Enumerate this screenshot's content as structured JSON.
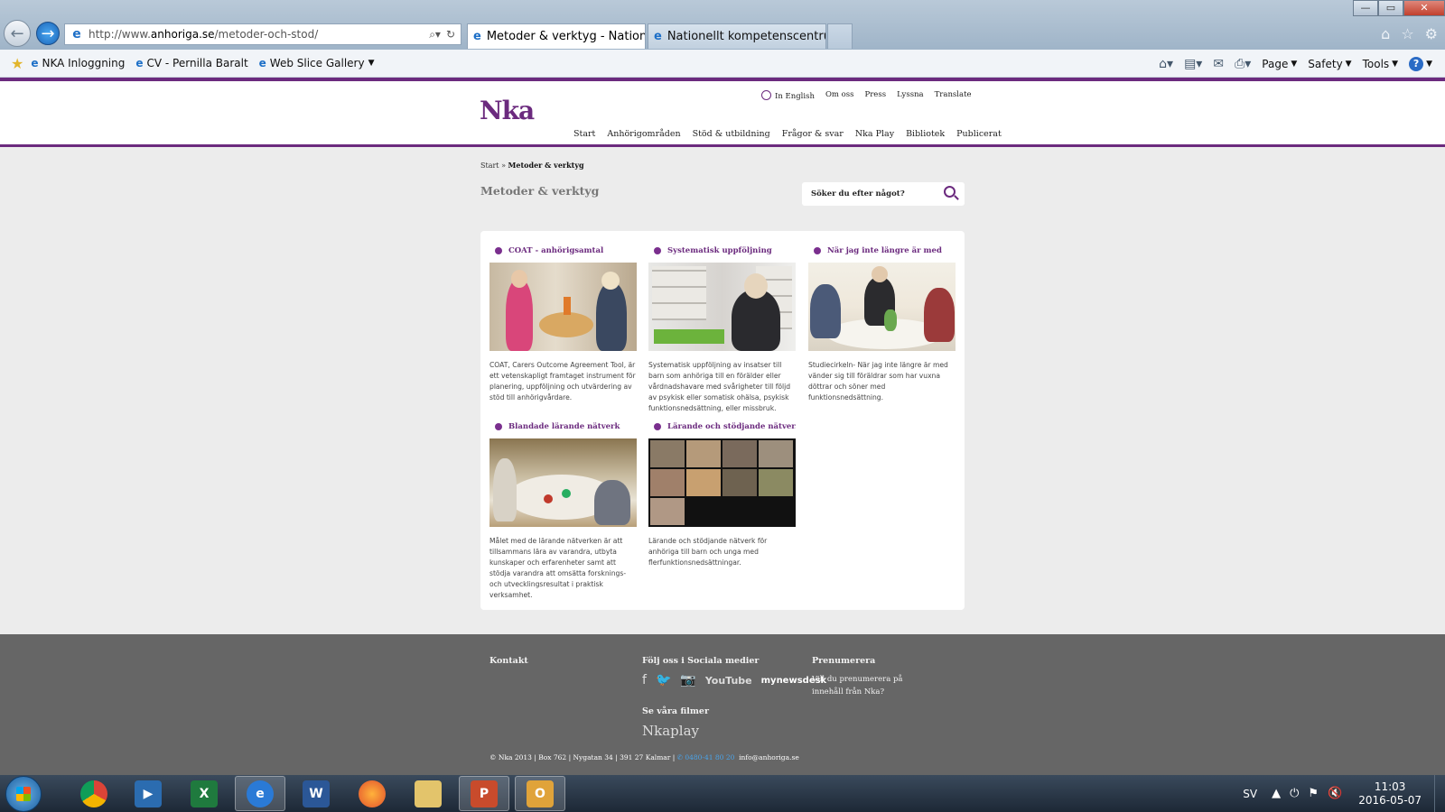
{
  "browser": {
    "url_prefix": "http://www.",
    "url_domain": "anhoriga.se",
    "url_path": "/metoder-och-stod/",
    "tabs": [
      {
        "label": "Metoder & verktyg - Nation...",
        "close": "×"
      },
      {
        "label": "Nationellt kompetenscentrum ..."
      }
    ],
    "window": {
      "minimize": "—",
      "restore": "▭",
      "close": "✕"
    },
    "favorites": [
      {
        "label": "NKA  Inloggning"
      },
      {
        "label": "CV - Pernilla Baralt"
      },
      {
        "label": "Web Slice Gallery"
      }
    ],
    "commands": {
      "page": "Page",
      "safety": "Safety",
      "tools": "Tools"
    }
  },
  "site": {
    "logo": "Nka",
    "util_nav": [
      "In English",
      "Om oss",
      "Press",
      "Lyssna",
      "Translate"
    ],
    "main_nav": [
      "Start",
      "Anhörigområden",
      "Stöd & utbildning",
      "Frågor & svar",
      "Nka Play",
      "Bibliotek",
      "Publicerat"
    ],
    "breadcrumb": {
      "root": "Start",
      "sep": "»",
      "current": "Metoder & verktyg"
    },
    "page_title": "Metoder & verktyg",
    "search_placeholder": "Söker du efter något?",
    "cards": [
      {
        "title": "COAT - anhörigsamtal",
        "desc": "COAT, Carers Outcome Agreement Tool, är ett vetenskapligt framtaget instrument för planering, uppföljning och utvärdering av stöd till anhörigvårdare."
      },
      {
        "title": "Systematisk uppföljning",
        "desc": "Systematisk uppföljning av insatser till barn som anhöriga till en förälder eller vårdnadshavare med svårigheter till följd av psykisk eller somatisk ohälsa, psykisk funktionsnedsättning, eller missbruk."
      },
      {
        "title": "När jag inte längre är med",
        "desc": "Studiecirkeln- När jag inte längre är med vänder sig till föräldrar som har vuxna döttrar och söner med funktionsnedsättning."
      },
      {
        "title": "Blandade lärande nätverk",
        "desc": "Målet med de lärande nätverken är att tillsammans lära av varandra, utbyta kunskaper och erfarenheter samt att stödja varandra att omsätta forsknings- och utvecklingsresultat i praktisk verksamhet."
      },
      {
        "title": "Lärande och stödjande nätver...",
        "desc": "Lärande och stödjande nätverk för anhöriga till barn och unga med flerfunktionsnedsättningar."
      }
    ],
    "footer": {
      "contact_heading": "Kontakt",
      "social_heading": "Följ oss i Sociala medier",
      "social": {
        "facebook": "f",
        "twitter": "🐦",
        "instagram": "📷",
        "youtube": "YouTube",
        "newsdesk": "mynewsdesk"
      },
      "films_heading": "Se våra filmer",
      "play_logo_a": "Nka",
      "play_logo_b": "play",
      "subscribe_heading": "Prenumerera",
      "subscribe_text": "Vill du prenumerera på innehåll från Nka?",
      "address": "© Nka 2013 | Box 762 | Nygatan 34 | 391 27 Kalmar |",
      "phone": "0480-41 80 20",
      "email": "info@anhoriga.se"
    }
  },
  "taskbar": {
    "language": "SV",
    "time": "11:03",
    "date": "2016-05-07"
  },
  "colors": {
    "brand_purple": "#6b2a7e",
    "footer_bg": "#666666",
    "page_bg": "#ececec"
  }
}
